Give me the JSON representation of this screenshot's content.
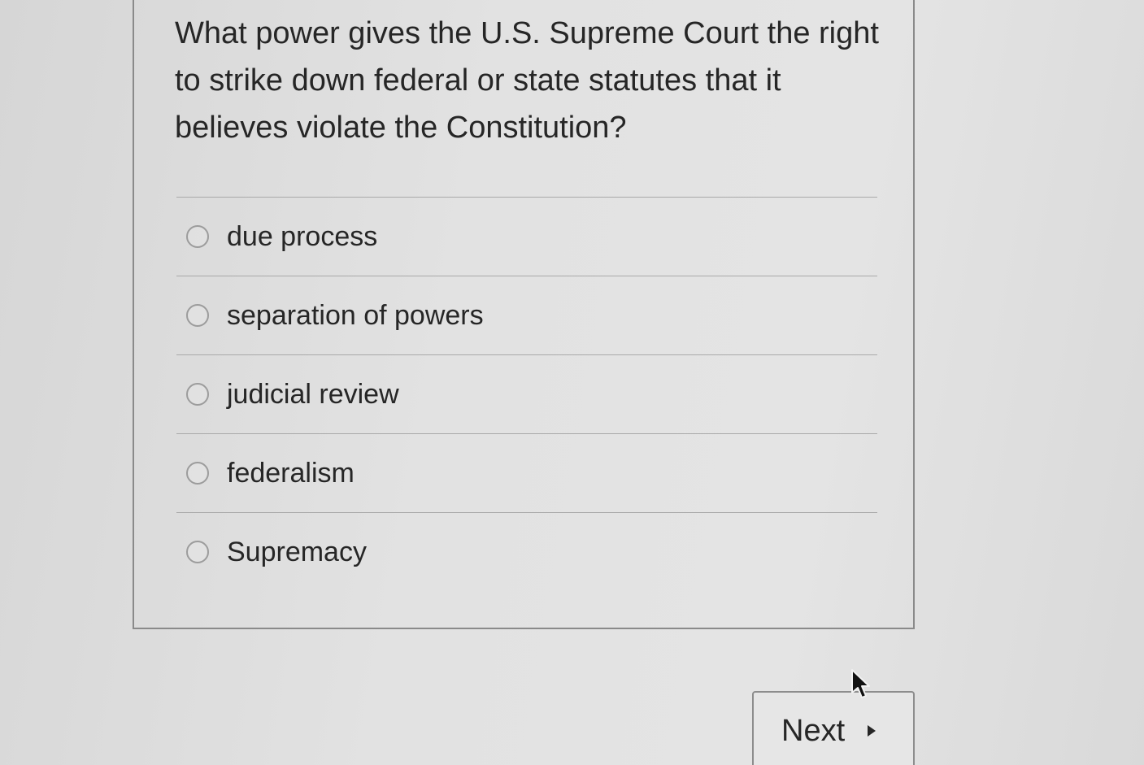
{
  "question": {
    "text": "What power gives the U.S. Supreme Court the right to strike down federal or state statutes that it believes violate the Constitution?"
  },
  "options": [
    {
      "label": "due process",
      "selected": false
    },
    {
      "label": "separation of powers",
      "selected": false
    },
    {
      "label": "judicial review",
      "selected": false
    },
    {
      "label": "federalism",
      "selected": false
    },
    {
      "label": "Supremacy",
      "selected": false
    }
  ],
  "navigation": {
    "next_label": "Next",
    "next_icon": "triangle-right-icon"
  },
  "cursor": {
    "icon": "mouse-pointer-icon"
  }
}
